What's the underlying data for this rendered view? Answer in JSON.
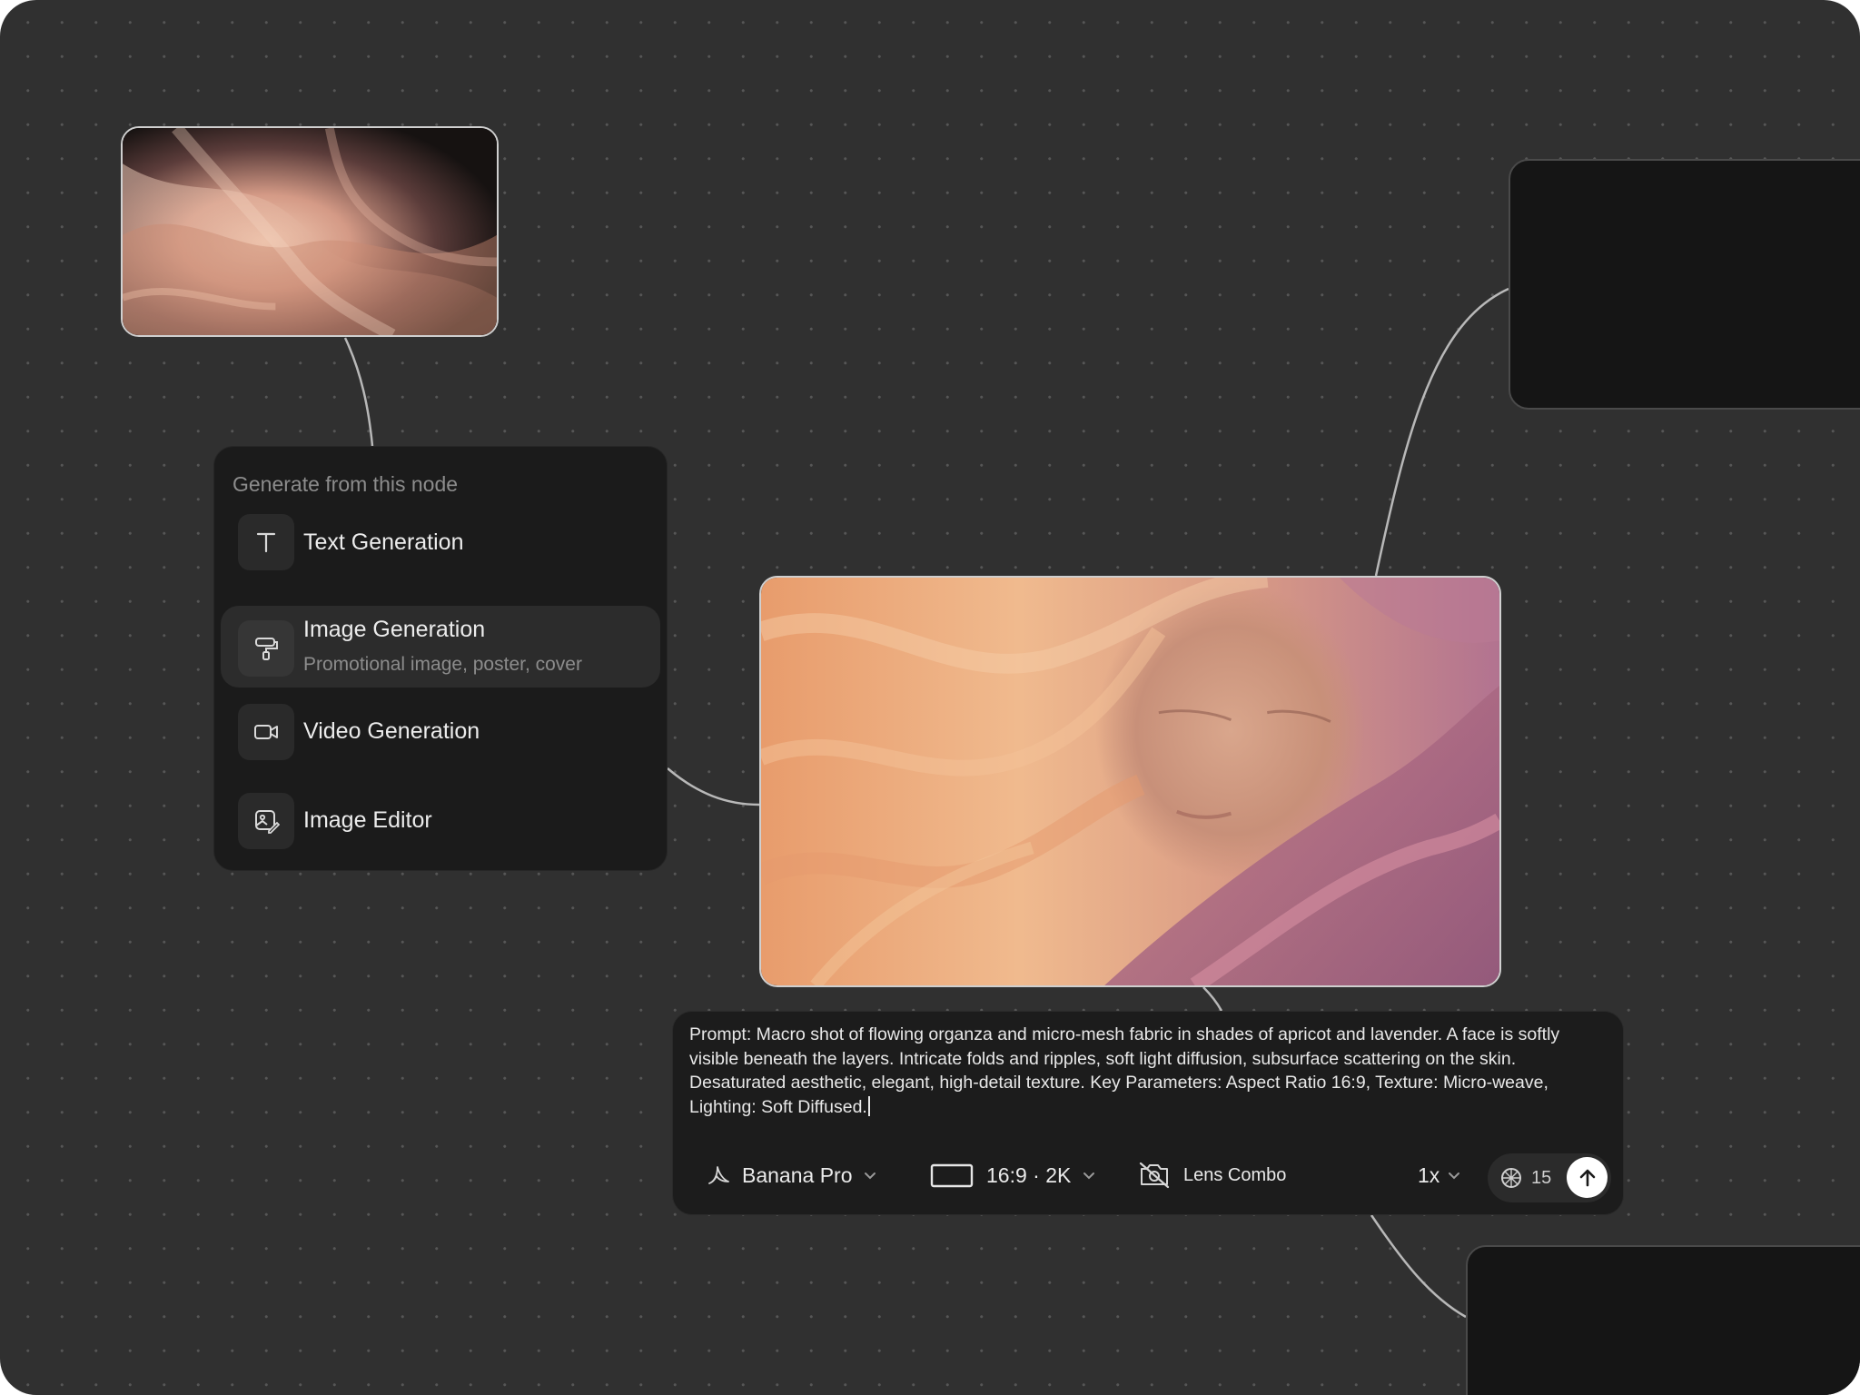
{
  "menu": {
    "header": "Generate from this node",
    "items": [
      {
        "label": "Text Generation",
        "icon": "text-t-icon"
      },
      {
        "label": "Image Generation",
        "sublabel": "Promotional image, poster, cover",
        "icon": "paint-roller-icon"
      },
      {
        "label": "Video Generation",
        "icon": "video-camera-icon"
      },
      {
        "label": "Image Editor",
        "icon": "image-edit-icon"
      }
    ]
  },
  "prompt": {
    "text": "Prompt: Macro shot of flowing organza and micro-mesh fabric in shades of apricot and lavender. A face is softly visible beneath the layers. Intricate folds and ripples, soft light diffusion, subsurface scattering on the skin. Desaturated aesthetic, elegant, high-detail texture. Key Parameters: Aspect Ratio 16:9, Texture: Micro-weave, Lighting: Soft Diffused."
  },
  "toolbar": {
    "model": "Banana Pro",
    "aspect": "16:9 · 2K",
    "lens": "Lens Combo",
    "count": "1x",
    "credits": "15"
  },
  "colors": {
    "canvas": "#303030",
    "panel": "#1b1b1b",
    "connector": "#b8b8b8",
    "apricot": "#e9a57b",
    "lavender": "#b8778f"
  }
}
